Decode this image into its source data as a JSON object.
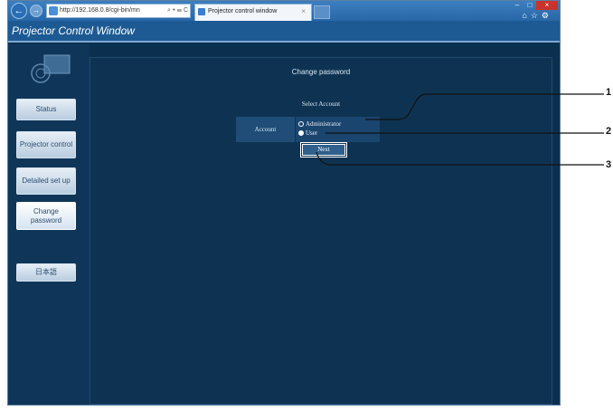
{
  "browser": {
    "address": "http://192.168.0.8/cgi-bin/mn",
    "address_controls": "⌕ ▾ ☰ C",
    "tab_title": "Projector control window",
    "tab_close": "×",
    "window_min": "‒",
    "window_max": "□",
    "window_close": "×",
    "toolbar_icons": "⌂☆⚙",
    "back_glyph": "←",
    "fwd_glyph": "→"
  },
  "page": {
    "title": "Projector Control Window"
  },
  "sidebar": {
    "status": "Status",
    "projector_control": "Projector control",
    "detailed_setup": "Detailed set up",
    "change_password": "Change password",
    "language": "日本語"
  },
  "main": {
    "title": "Change password",
    "select_account": "Select Account",
    "account_label": "Account",
    "options": [
      {
        "label": "Administrator",
        "selected": false
      },
      {
        "label": "User",
        "selected": true
      }
    ],
    "next_label": "Next"
  },
  "callouts": [
    "1",
    "2",
    "3"
  ],
  "colors": {
    "header": "#1d5a94",
    "sidebar": "#0f3659",
    "panel": "#0e3352",
    "titlebar": "#2867a8",
    "close": "#c9332b"
  }
}
